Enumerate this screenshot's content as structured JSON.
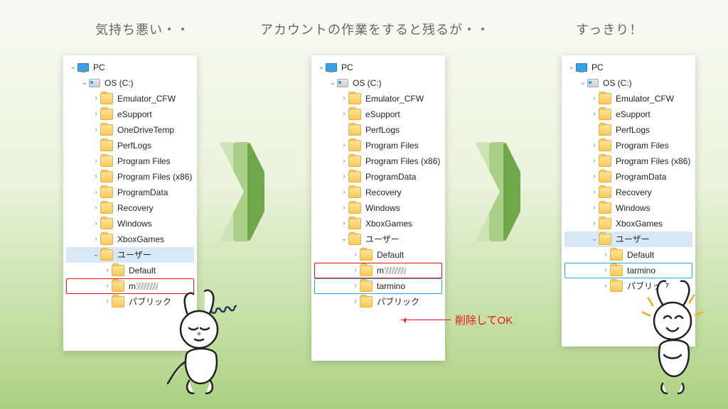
{
  "captions": {
    "c1": "気持ち悪い・・",
    "c2": "アカウントの作業をすると残るが・・",
    "c3": "すっきり！"
  },
  "callout": "削除してOK",
  "common_top": [
    {
      "ind": 0,
      "tw": "open",
      "ic": "pc",
      "label": "PC",
      "sel": false
    },
    {
      "ind": 1,
      "tw": "open",
      "ic": "drv",
      "label": "OS (C:)",
      "sel": false
    },
    {
      "ind": 2,
      "tw": "closed",
      "ic": "fld",
      "label": "Emulator_CFW"
    },
    {
      "ind": 2,
      "tw": "closed",
      "ic": "fld",
      "label": "eSupport"
    },
    {
      "ind": 2,
      "tw": "closed",
      "ic": "fld",
      "label": "OneDriveTemp",
      "panelOnly": 1
    },
    {
      "ind": 2,
      "tw": "none",
      "ic": "fld",
      "label": "PerfLogs"
    },
    {
      "ind": 2,
      "tw": "closed",
      "ic": "fld",
      "label": "Program Files"
    },
    {
      "ind": 2,
      "tw": "closed",
      "ic": "fld",
      "label": "Program Files (x86)"
    },
    {
      "ind": 2,
      "tw": "closed",
      "ic": "fld",
      "label": "ProgramData"
    },
    {
      "ind": 2,
      "tw": "closed",
      "ic": "fld",
      "label": "Recovery"
    },
    {
      "ind": 2,
      "tw": "closed",
      "ic": "fld",
      "label": "Windows"
    },
    {
      "ind": 2,
      "tw": "closed",
      "ic": "fld",
      "label": "XboxGames"
    }
  ],
  "panel1_users": [
    {
      "ind": 2,
      "tw": "open",
      "ic": "fld",
      "label": "ユーザー",
      "sel": true
    },
    {
      "ind": 3,
      "tw": "closed",
      "ic": "fld",
      "label": "Default"
    },
    {
      "ind": 3,
      "tw": "closed",
      "ic": "fld",
      "label": "m",
      "obsc": true,
      "red": true
    },
    {
      "ind": 3,
      "tw": "closed",
      "ic": "fld",
      "label": "パブリック"
    }
  ],
  "panel2_users": [
    {
      "ind": 2,
      "tw": "open",
      "ic": "fld",
      "label": "ユーザー"
    },
    {
      "ind": 3,
      "tw": "closed",
      "ic": "fld",
      "label": "Default"
    },
    {
      "ind": 3,
      "tw": "closed",
      "ic": "fld",
      "label": "m",
      "obsc": true,
      "red": true
    },
    {
      "ind": 3,
      "tw": "closed",
      "ic": "fld",
      "label": "tarmino",
      "blue": true
    },
    {
      "ind": 3,
      "tw": "closed",
      "ic": "fld",
      "label": "パブリック"
    }
  ],
  "panel3_users": [
    {
      "ind": 2,
      "tw": "open",
      "ic": "fld",
      "label": "ユーザー",
      "sel": true
    },
    {
      "ind": 3,
      "tw": "closed",
      "ic": "fld",
      "label": "Default"
    },
    {
      "ind": 3,
      "tw": "closed",
      "ic": "fld",
      "label": "tarmino",
      "blue": true
    },
    {
      "ind": 3,
      "tw": "closed",
      "ic": "fld",
      "label": "パブリック"
    }
  ]
}
